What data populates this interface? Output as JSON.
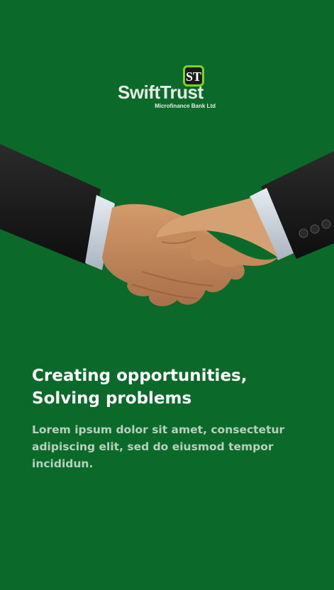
{
  "brand": {
    "name": "SwiftTrust",
    "subtitle": "Microfinance Bank Ltd",
    "badge_letters": "ST",
    "accent_color": "#7ed321",
    "background_color": "#0b6a2a"
  },
  "hero": {
    "icon": "handshake-illustration"
  },
  "onboarding": {
    "headline_line1": "Creating opportunities,",
    "headline_line2": "Solving problems",
    "description": "Lorem ipsum dolor sit amet, consectetur adipiscing elit, sed do eiusmod tempor incididun."
  }
}
